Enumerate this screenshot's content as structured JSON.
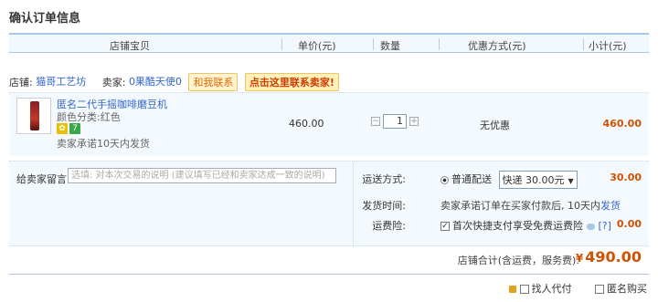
{
  "page_title": "确认订单信息",
  "columns": {
    "shop_item": "店铺宝贝",
    "unit_price": "单价(元)",
    "quantity": "数量",
    "discount": "优惠方式(元)",
    "subtotal": "小计(元)"
  },
  "shop": {
    "label": "店铺:",
    "name": "猫哥工艺坊",
    "seller_label": "卖家:",
    "seller_name": "0果酷天使0",
    "contact_btn": "和我联系",
    "contact_btn2": "点击这里联系卖家!"
  },
  "item": {
    "name": "匿名二代手摇咖啡磨豆机",
    "attr": "颜色分类:红色",
    "badge_text": "7",
    "promise": "卖家承诺10天内发货",
    "unit_price": "460.00",
    "quantity": "1",
    "qty_minus": "−",
    "qty_plus": "+",
    "discount": "无优惠",
    "subtotal": "460.00"
  },
  "message": {
    "label": "给卖家留言:",
    "placeholder": "选填: 对本次交易的说明 (建议填写已经和卖家达成一致的说明)"
  },
  "shipping": {
    "label": "运送方式:",
    "option": "普通配送",
    "selected": "快递 30.00元",
    "fee": "30.00"
  },
  "delivery": {
    "label": "发货时间:",
    "text": "卖家承诺订单在买家付款后, 10天内",
    "link": "发货"
  },
  "insurance": {
    "label": "运费险:",
    "text": "首次快捷支付享受免费运费险",
    "help": "[?]",
    "fee": "0.00"
  },
  "total": {
    "label": "店铺合计(含运费，服务费):",
    "currency": "¥",
    "value": "490.00"
  },
  "options": {
    "proxy_pay": "找人代付",
    "anonymous": "匿名购买"
  },
  "colors": {
    "accent_blue": "#3366cc",
    "price_orange": "#d05100",
    "header_border": "#aac8e8"
  }
}
